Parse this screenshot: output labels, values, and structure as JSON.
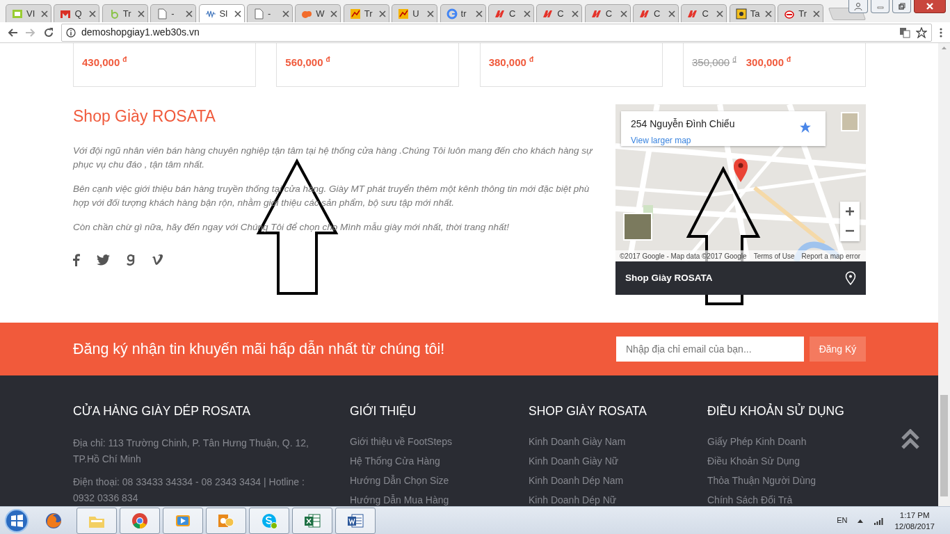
{
  "browser": {
    "tabs": [
      {
        "label": "VI",
        "selected": false
      },
      {
        "label": "Q",
        "selected": false
      },
      {
        "label": "Tr",
        "selected": false
      },
      {
        "label": "-",
        "selected": false
      },
      {
        "label": "Sl",
        "selected": true
      },
      {
        "label": "-",
        "selected": false
      },
      {
        "label": "W",
        "selected": false
      },
      {
        "label": "Tr",
        "selected": false
      },
      {
        "label": "U",
        "selected": false
      },
      {
        "label": "tr",
        "selected": false
      },
      {
        "label": "C",
        "selected": false
      },
      {
        "label": "C",
        "selected": false
      },
      {
        "label": "C",
        "selected": false
      },
      {
        "label": "C",
        "selected": false
      },
      {
        "label": "C",
        "selected": false
      },
      {
        "label": "Ta",
        "selected": false
      },
      {
        "label": "Tr",
        "selected": false
      }
    ],
    "address": "demoshopgiay1.web30s.vn"
  },
  "products": [
    {
      "price": "430,000",
      "currency": "đ"
    },
    {
      "price": "560,000",
      "currency": "đ"
    },
    {
      "price": "380,000",
      "currency": "đ"
    },
    {
      "old_price": "350,000",
      "old_currency": "đ",
      "price": "300,000",
      "currency": "đ"
    }
  ],
  "about": {
    "title": "Shop Giày ROSATA",
    "paragraphs": [
      "Với đội ngũ nhân viên bán hàng chuyên nghiệp tận tâm tại hệ thống cửa hàng .Chúng Tôi luôn mang đến cho khách hàng sự phục vụ chu đáo , tận tâm nhất.",
      "Bên cạnh việc giới thiệu bán hàng truyền thống tại cửa hàng. Giày MT phát truyển thêm một kênh thông tin mới đặc biệt phù hợp với đối tượng khách hàng bận rộn, nhằm giới thiệu các sản phẩm, bộ sưu tập mới nhất.",
      "Còn chần chừ gì nữa, hãy đến ngay với Chúng Tôi để chọn cho Mình mẫu giày mới nhất, thời trang nhất!"
    ]
  },
  "map": {
    "place": "254 Nguyễn Đình Chiểu",
    "link": "View larger map",
    "attribution": "©2017 Google - Map data ©2017 Google",
    "terms": "Terms of Use",
    "report": "Report a map error",
    "bar_label": "Shop Giày ROSATA"
  },
  "newsletter": {
    "title": "Đăng ký nhận tin khuyến mãi hấp dẫn nhất từ chúng tôi!",
    "placeholder": "Nhập địa chỉ email của bạn...",
    "button": "Đăng Ký"
  },
  "footer": [
    {
      "heading": "CỬA HÀNG GIÀY DÉP ROSATA",
      "kind": "text",
      "items": [
        "Địa chỉ: 113 Trường Chinh, P. Tân Hưng Thuận, Q. 12, TP.Hồ Chí Minh",
        "Điện thoại: 08 33433 34334 - 08 2343 3434 | Hotline : 0932 0336 834"
      ]
    },
    {
      "heading": "GIỚI THIỆU",
      "kind": "links",
      "items": [
        "Giới thiệu về FootSteps",
        "Hệ Thống Cửa Hàng",
        "Hướng Dẫn Chọn Size",
        "Hướng Dẫn Mua Hàng"
      ]
    },
    {
      "heading": "SHOP GIÀY ROSATA",
      "kind": "links",
      "items": [
        "Kinh Doanh Giày Nam",
        "Kinh Doanh Giày Nữ",
        "Kinh Doanh Dép Nam",
        "Kinh Doanh Dép Nữ"
      ]
    },
    {
      "heading": "ĐIỀU KHOẢN SỬ DỤNG",
      "kind": "links",
      "items": [
        "Giấy Phép Kinh Doanh",
        "Điều Khoản Sử Dụng",
        "Thỏa Thuận Người Dùng",
        "Chính Sách Đổi Trả"
      ]
    }
  ],
  "taskbar": {
    "language": "EN",
    "time": "1:17 PM",
    "date": "12/08/2017"
  }
}
